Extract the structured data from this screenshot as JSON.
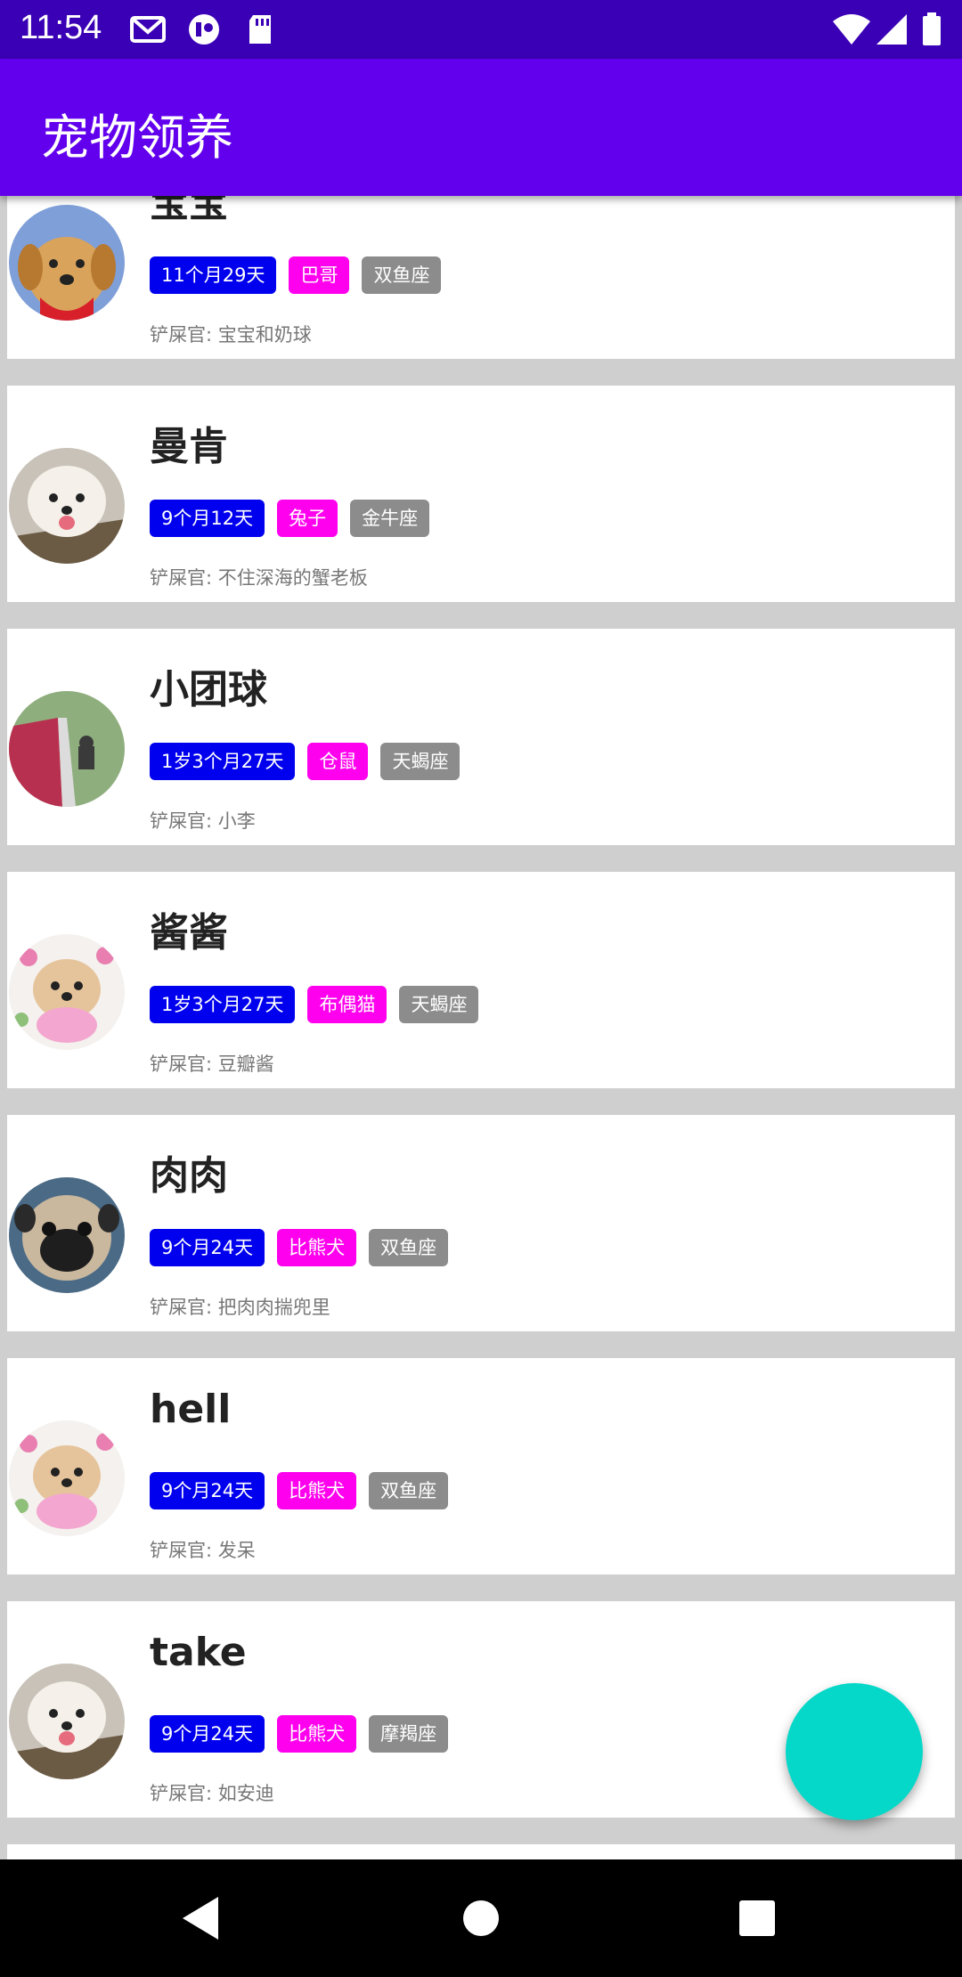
{
  "status_bar": {
    "time": "11:54",
    "left_icons": [
      "gmail-icon",
      "app-icon",
      "sd-card-icon"
    ],
    "right_icons": [
      "wifi-icon",
      "signal-icon",
      "battery-icon"
    ]
  },
  "app_bar": {
    "title": "宠物领养",
    "color": "#6200ee"
  },
  "colors": {
    "age_tag": "#0000ee",
    "breed_tag": "#ff00ee",
    "zodiac_tag": "#8c8c8c",
    "fab": "#05d8c8"
  },
  "pets": [
    {
      "name": "宝宝",
      "age": "11个月29天",
      "breed": "巴哥",
      "zodiac": "双鱼座",
      "owner": "铲屎官: 宝宝和奶球",
      "avatar": "golden-puppy"
    },
    {
      "name": "曼肯",
      "age": "9个月12天",
      "breed": "兔子",
      "zodiac": "金牛座",
      "owner": "铲屎官: 不住深海的蟹老板",
      "avatar": "white-poodle"
    },
    {
      "name": "小团球",
      "age": "1岁3个月27天",
      "breed": "仓鼠",
      "zodiac": "天蝎座",
      "owner": "铲屎官: 小李",
      "avatar": "dog-on-grass"
    },
    {
      "name": "酱酱",
      "age": "1岁3个月27天",
      "breed": "布偶猫",
      "zodiac": "天蝎座",
      "owner": "铲屎官: 豆瓣酱",
      "avatar": "flower-poodle"
    },
    {
      "name": "肉肉",
      "age": "9个月24天",
      "breed": "比熊犬",
      "zodiac": "双鱼座",
      "owner": "铲屎官: 把肉肉揣兜里",
      "avatar": "pug"
    },
    {
      "name": "hell",
      "age": "9个月24天",
      "breed": "比熊犬",
      "zodiac": "双鱼座",
      "owner": "铲屎官: 发呆",
      "avatar": "flower-poodle"
    },
    {
      "name": "take",
      "age": "9个月24天",
      "breed": "比熊犬",
      "zodiac": "摩羯座",
      "owner": "铲屎官: 如安迪",
      "avatar": "white-poodle"
    }
  ],
  "nav_bar": {
    "buttons": [
      "back-icon",
      "home-icon",
      "recents-icon"
    ]
  }
}
